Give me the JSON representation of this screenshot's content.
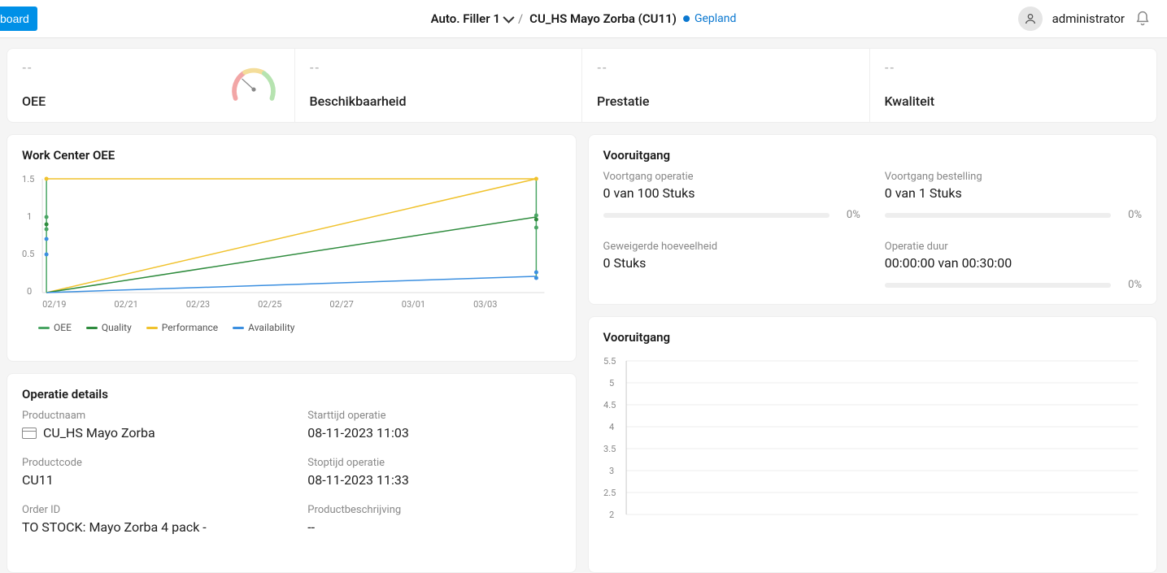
{
  "topbar": {
    "board_button": "board",
    "work_center": "Auto. Filler 1",
    "operation": "CU_HS Mayo Zorba (CU11)",
    "status": "Gepland",
    "username": "administrator"
  },
  "kpis": {
    "oee": {
      "dash": "--",
      "label": "OEE"
    },
    "availability": {
      "dash": "--",
      "label": "Beschikbaarheid"
    },
    "performance": {
      "dash": "--",
      "label": "Prestatie"
    },
    "quality": {
      "dash": "--",
      "label": "Kwaliteit"
    }
  },
  "chart1": {
    "title": "Work Center OEE",
    "legend": {
      "oee": "OEE",
      "quality": "Quality",
      "performance": "Performance",
      "availability": "Availability"
    },
    "colors": {
      "oee": "#4aa564",
      "quality": "#2e8b3d",
      "performance": "#f0c22d",
      "availability": "#3b8fe0"
    }
  },
  "progress": {
    "title": "Vooruitgang",
    "op_progress_label": "Voortgang operatie",
    "op_progress_value": "0 van 100 Stuks",
    "op_progress_pct": "0%",
    "order_progress_label": "Voortgang bestelling",
    "order_progress_value": "0 van 1 Stuks",
    "order_progress_pct": "0%",
    "rejected_label": "Geweigerde hoeveelheid",
    "rejected_value": "0 Stuks",
    "duration_label": "Operatie duur",
    "duration_value": "00:00:00 van 00:30:00",
    "duration_pct": "0%"
  },
  "details": {
    "title": "Operatie details",
    "product_name_label": "Productnaam",
    "product_name": "CU_HS Mayo Zorba",
    "product_code_label": "Productcode",
    "product_code": "CU11",
    "order_id_label": "Order ID",
    "order_id": "TO STOCK: Mayo Zorba 4 pack -",
    "start_label": "Starttijd operatie",
    "start_value": "08-11-2023 11:03",
    "stop_label": "Stoptijd operatie",
    "stop_value": "08-11-2023 11:33",
    "desc_label": "Productbeschrijving",
    "desc_value": "--"
  },
  "chart2": {
    "title": "Vooruitgang"
  },
  "chart_data": [
    {
      "type": "line",
      "title": "Work Center OEE",
      "x": [
        "02/19",
        "02/21",
        "02/23",
        "02/25",
        "02/27",
        "03/01",
        "03/03"
      ],
      "ylim": [
        0,
        1.5
      ],
      "yticks": [
        0,
        0.5,
        1,
        1.5
      ],
      "series": [
        {
          "name": "OEE",
          "color": "#4aa564",
          "values": [
            0.9,
            null,
            null,
            null,
            null,
            null,
            1.0
          ]
        },
        {
          "name": "Quality",
          "color": "#2e8b3d",
          "values": [
            0.85,
            null,
            null,
            null,
            null,
            null,
            1.0
          ]
        },
        {
          "name": "Performance",
          "color": "#f0c22d",
          "values": [
            1.5,
            null,
            null,
            null,
            null,
            null,
            1.5
          ]
        },
        {
          "name": "Availability",
          "color": "#3b8fe0",
          "values": [
            0.7,
            null,
            null,
            null,
            null,
            null,
            0.2
          ]
        }
      ],
      "legend_position": "bottom",
      "grid": false
    },
    {
      "type": "line",
      "title": "Vooruitgang",
      "yticks": [
        2,
        2.5,
        3,
        3.5,
        4,
        4.5,
        5,
        5.5
      ],
      "ylim": [
        2,
        5.5
      ],
      "series": [],
      "grid": true
    }
  ]
}
